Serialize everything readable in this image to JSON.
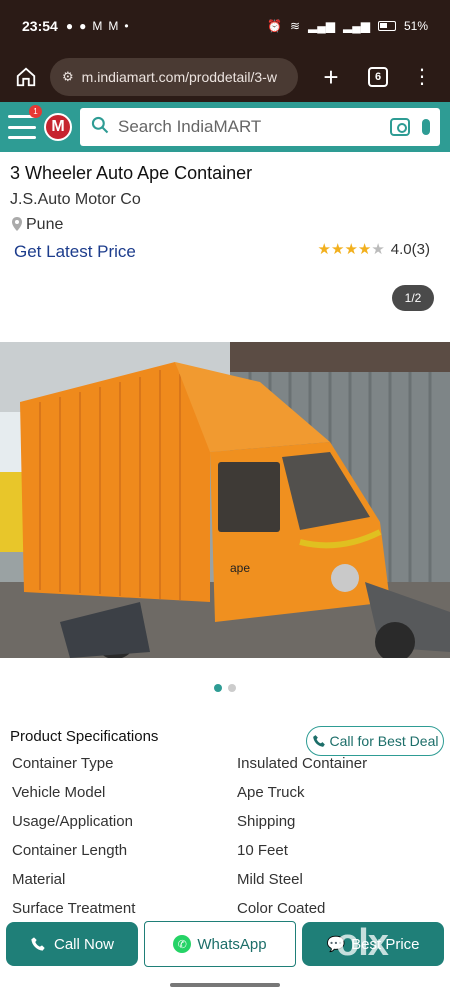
{
  "status_bar": {
    "time": "23:54",
    "battery": "51%",
    "notification_icons": [
      "sms-icon",
      "chat-icon",
      "gmail-icon",
      "gmail-icon"
    ]
  },
  "browser": {
    "url": "m.indiamart.com/proddetail/3-w",
    "tab_count": "6"
  },
  "header": {
    "menu_badge": "1",
    "logo_letter": "M",
    "search_placeholder": "Search IndiaMART"
  },
  "product": {
    "title": "3 Wheeler Auto Ape Container",
    "company": "J.S.Auto Motor Co",
    "location": "Pune",
    "latest_price_label": "Get Latest Price",
    "rating_value": "4.0",
    "rating_count": "(3)",
    "rating_stars": 4,
    "image_counter": "1/2",
    "image_label_vehicle": "ape",
    "carousel_total": 2,
    "carousel_active": 1
  },
  "specifications": {
    "title": "Product Specifications",
    "call_button": "Call for Best Deal",
    "rows": [
      {
        "key": "Container Type",
        "value": "Insulated Container"
      },
      {
        "key": "Vehicle Model",
        "value": "Ape Truck"
      },
      {
        "key": "Usage/Application",
        "value": "Shipping"
      },
      {
        "key": "Container Length",
        "value": "10 Feet"
      },
      {
        "key": "Material",
        "value": "Mild Steel"
      },
      {
        "key": "Surface Treatment",
        "value": "Color Coated"
      }
    ]
  },
  "actions": {
    "call_now": "Call Now",
    "whatsapp": "WhatsApp",
    "best_price": "Best Price"
  },
  "watermark": "olx",
  "colors": {
    "brand_teal": "#2e9c94",
    "action_teal": "#1f7f78",
    "price_link": "#1c3c8c",
    "star": "#f2b01e",
    "container_orange": "#ef8a1c"
  }
}
